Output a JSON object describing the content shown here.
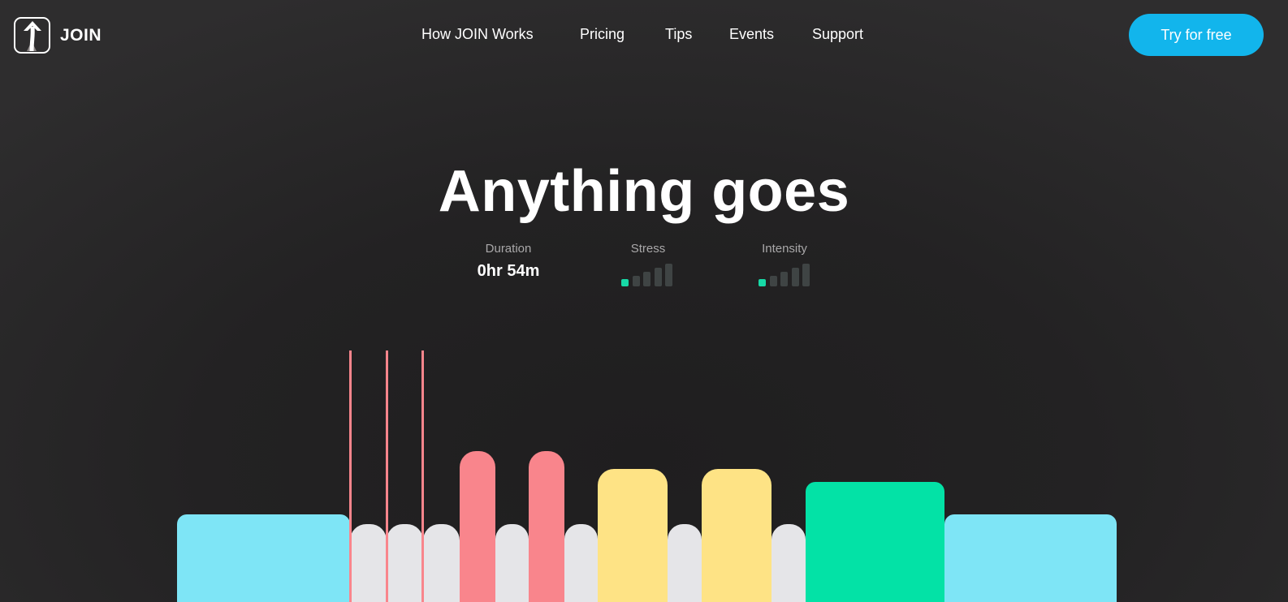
{
  "brand": {
    "name": "JOIN",
    "logo_icon": "up-arrow-logo-icon"
  },
  "nav": {
    "items": [
      {
        "label": "How JOIN Works"
      },
      {
        "label": "Pricing"
      },
      {
        "label": "Tips"
      },
      {
        "label": "Events"
      },
      {
        "label": "Support"
      }
    ],
    "cta_label": "Try for free"
  },
  "hero": {
    "title": "Anything goes",
    "stats": {
      "duration": {
        "label": "Duration",
        "value": "0hr 54m"
      },
      "stress": {
        "label": "Stress",
        "level": 1,
        "max": 5
      },
      "intensity": {
        "label": "Intensity",
        "level": 1,
        "max": 5
      }
    }
  },
  "colors": {
    "accent": "#12b5ec",
    "cyan": "#7ee5f6",
    "gray": "#e5e5e8",
    "pink": "#f9858c",
    "yellow": "#fee385",
    "green": "#03e2a6",
    "level_on": "#17d9a6",
    "level_off": "#3f4444"
  },
  "workout_blocks": [
    {
      "type": "cyan",
      "level": 0.54
    },
    {
      "type": "gray",
      "level": 0.48
    },
    {
      "type": "gray",
      "level": 0.48
    },
    {
      "type": "gray",
      "level": 0.48
    },
    {
      "type": "pink",
      "level": 0.93
    },
    {
      "type": "gray",
      "level": 0.48
    },
    {
      "type": "pink",
      "level": 0.93
    },
    {
      "type": "gray",
      "level": 0.48
    },
    {
      "type": "yellow",
      "level": 0.82
    },
    {
      "type": "gray",
      "level": 0.48
    },
    {
      "type": "yellow",
      "level": 0.82
    },
    {
      "type": "gray",
      "level": 0.48
    },
    {
      "type": "green",
      "level": 0.74
    },
    {
      "type": "cyan",
      "level": 0.54
    }
  ],
  "markers": 3
}
